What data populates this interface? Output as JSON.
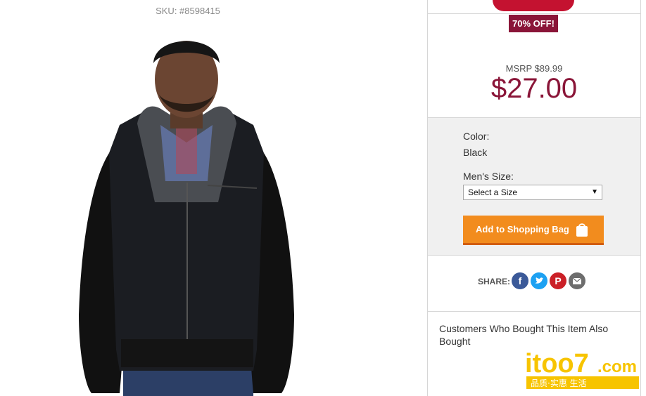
{
  "product": {
    "sku": "SKU: #8598415",
    "image_alt": "Man wearing black jacket with leather sleeves and grey hood"
  },
  "pricing": {
    "discount_badge": "70% OFF!",
    "msrp": "MSRP $89.99",
    "price": "$27.00",
    "accent_color": "#8a1538"
  },
  "options": {
    "color_label": "Color:",
    "color_value": "Black",
    "size_label": "Men's Size:",
    "size_selected": "Select a Size"
  },
  "actions": {
    "add_to_bag": "Add to Shopping Bag",
    "button_color": "#f28c1e"
  },
  "share": {
    "label": "SHARE:",
    "icons": [
      "facebook-icon",
      "twitter-icon",
      "pinterest-icon",
      "email-icon"
    ]
  },
  "recommendations": {
    "title": "Customers Who Bought This Item Also Bought"
  },
  "watermark": {
    "brand": "itoo7",
    "domain": ".com",
    "tagline": "品质·实惠 生活"
  }
}
